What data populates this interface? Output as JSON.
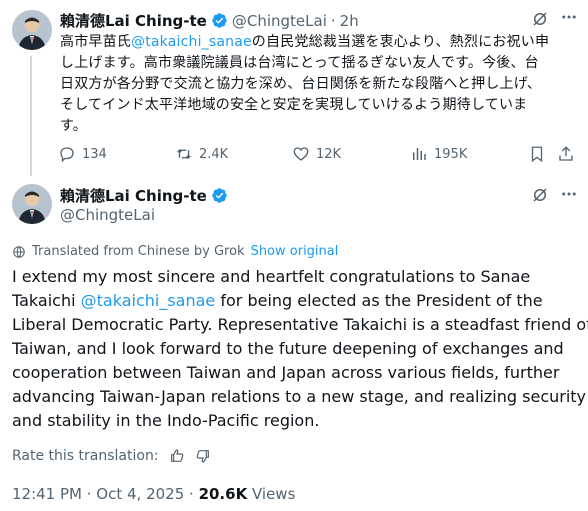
{
  "top_tweet": {
    "author_name": "賴清德Lai Ching-te",
    "handle": "@ChingteLai",
    "separator": "·",
    "time": "2h",
    "text_before_mention": "高市早苗氏",
    "mention": "@takaichi_sanae",
    "text_line1_after": "の自民党総裁当選を衷心より、熱烈にお祝い申",
    "text_line2": "し上げます。高市衆議院議員は台湾にとって揺るぎない友人です。今後、台",
    "text_line3": "日双方が各分野で交流と協力を深め、台日関係を新たな段階へと押し上げ、",
    "text_line4": "そしてインド太平洋地域の安全と安定を実現していけるよう期待していま",
    "text_line5": "す。",
    "stats": {
      "replies": "134",
      "reposts": "2.4K",
      "likes": "12K",
      "views": "195K"
    }
  },
  "main_tweet": {
    "author_name": "賴清德Lai Ching-te",
    "handle": "@ChingteLai",
    "translated_label": "Translated from Chinese by Grok",
    "show_original": "Show original",
    "text_line1": "I extend my most sincere and heartfelt congratulations to Sanae",
    "text_line2_before": "Takaichi ",
    "mention": "@takaichi_sanae",
    "text_line2_after": " for being elected as the President of the",
    "text_line3": "Liberal Democratic Party. Representative Takaichi is a steadfast friend of",
    "text_line4": "Taiwan, and I look forward to the future deepening of exchanges and",
    "text_line5": "cooperation between Taiwan and Japan across various fields, further",
    "text_line6": "advancing Taiwan-Japan relations to a new stage, and realizing security",
    "text_line7": "and stability in the Indo-Pacific region.",
    "rate_label": "Rate this translation:",
    "timestamp": "12:41 PM · Oct 4, 2025 · ",
    "views_count": "20.6K",
    "views_label": " Views"
  },
  "colors": {
    "accent": "#1d9bf0",
    "muted": "#536471",
    "verified": "#1d9bf0"
  },
  "icons": [
    "grok-icon",
    "more-icon",
    "reply-icon",
    "repost-icon",
    "like-icon",
    "views-icon",
    "bookmark-icon",
    "share-icon",
    "translate-icon",
    "thumbs-up-icon",
    "thumbs-down-icon",
    "verified-badge-icon"
  ]
}
